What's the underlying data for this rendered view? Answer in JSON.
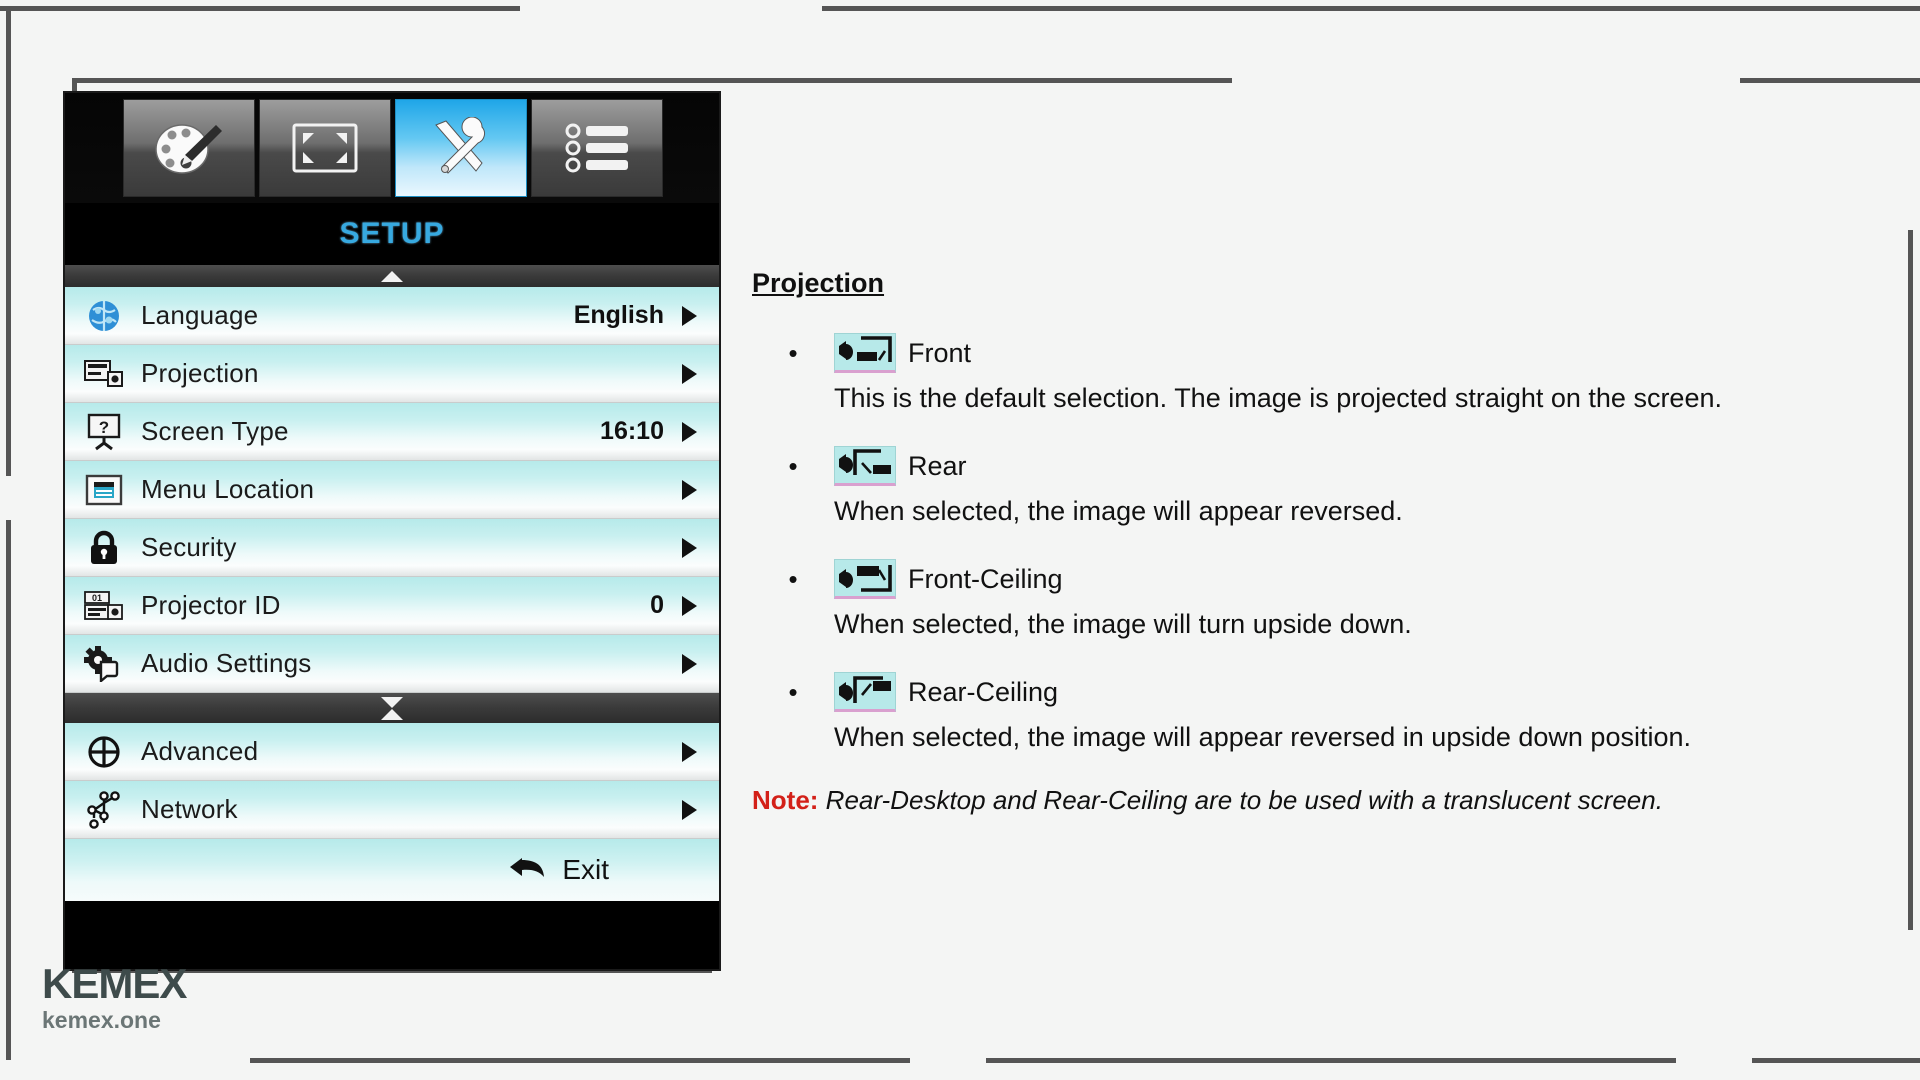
{
  "osd": {
    "title": "SETUP",
    "tabs": [
      {
        "name": "image-tab",
        "icon": "palette-brush-icon",
        "selected": false
      },
      {
        "name": "display-tab",
        "icon": "screen-resize-icon",
        "selected": false
      },
      {
        "name": "setup-tab",
        "icon": "tools-wrench-screwdriver-icon",
        "selected": true
      },
      {
        "name": "options-tab",
        "icon": "list-bullets-icon",
        "selected": false
      }
    ],
    "scroll_up_indicator": "▲",
    "scroll_down_indicator": "▼",
    "menu_items_top": [
      {
        "icon": "globe-icon",
        "label": "Language",
        "value": "English",
        "has_arrow": true
      },
      {
        "icon": "projection-screen-icon",
        "label": "Projection",
        "value": "",
        "has_arrow": true
      },
      {
        "icon": "screen-type-icon",
        "label": "Screen Type",
        "value": "16:10",
        "has_arrow": true
      },
      {
        "icon": "menu-location-icon",
        "label": "Menu Location",
        "value": "",
        "has_arrow": true
      },
      {
        "icon": "lock-icon",
        "label": "Security",
        "value": "",
        "has_arrow": true
      },
      {
        "icon": "projector-id-icon",
        "label": "Projector ID",
        "value": "0",
        "has_arrow": true
      },
      {
        "icon": "audio-settings-icon",
        "label": "Audio Settings",
        "value": "",
        "has_arrow": true
      }
    ],
    "menu_items_bottom": [
      {
        "icon": "advanced-crosshair-icon",
        "label": "Advanced",
        "value": "",
        "has_arrow": true
      },
      {
        "icon": "network-nodes-icon",
        "label": "Network",
        "value": "",
        "has_arrow": true
      }
    ],
    "exit": {
      "icon": "back-arrow-icon",
      "label": "Exit"
    }
  },
  "content": {
    "heading": "Projection",
    "bullet_char": "•",
    "options": [
      {
        "icon": "projection-front-icon",
        "name": "Front",
        "description": "This is the default selection. The image is projected straight on the screen."
      },
      {
        "icon": "projection-rear-icon",
        "name": "Rear",
        "description": "When selected, the image will appear reversed."
      },
      {
        "icon": "projection-front-ceiling-icon",
        "name": "Front-Ceiling",
        "description": "When selected, the image will turn upside down."
      },
      {
        "icon": "projection-rear-ceiling-icon",
        "name": "Rear-Ceiling",
        "description": "When selected, the image will appear reversed in upside down position."
      }
    ],
    "note_label": "Note:",
    "note_text": "Rear-Desktop and Rear-Ceiling are to be used with a translucent screen."
  },
  "logo": {
    "brand": "KEMEX",
    "domain": "kemex.one"
  },
  "colors": {
    "accent_blue": "#37a9e0",
    "tab_selected": "#64c8f2",
    "row_cyan": "#b6eaea",
    "note_red": "#d32018",
    "icon_badge_bg": "#b7e9e9",
    "icon_badge_underline": "#d9a0cf"
  }
}
